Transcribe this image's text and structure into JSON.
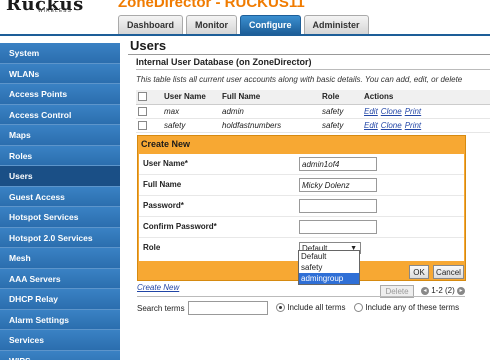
{
  "header": {
    "logo": "Ruckus",
    "logo_sub": "WIRELESS",
    "product_title": "ZoneDirector - RUCKUS11",
    "tabs": [
      "Dashboard",
      "Monitor",
      "Configure",
      "Administer"
    ],
    "active_tab": "Configure"
  },
  "sidebar": {
    "items": [
      {
        "label": "System"
      },
      {
        "label": "WLANs"
      },
      {
        "label": "Access Points"
      },
      {
        "label": "Access Control"
      },
      {
        "label": "Maps"
      },
      {
        "label": "Roles"
      },
      {
        "label": "Users",
        "active": true
      },
      {
        "label": "Guest Access"
      },
      {
        "label": "Hotspot Services"
      },
      {
        "label": "Hotspot 2.0 Services"
      },
      {
        "label": "Mesh"
      },
      {
        "label": "AAA Servers"
      },
      {
        "label": "DHCP Relay"
      },
      {
        "label": "Alarm Settings"
      },
      {
        "label": "Services"
      },
      {
        "label": "WIPS"
      }
    ]
  },
  "main": {
    "page_title": "Users",
    "section_title": "Internal User Database (on ZoneDirector)",
    "description": "This table lists all current user accounts along with basic details. You can add, edit, or delete",
    "table": {
      "columns": [
        "User Name",
        "Full Name",
        "Role",
        "Actions"
      ],
      "rows": [
        {
          "user": "max",
          "full": "admin",
          "role": "safety"
        },
        {
          "user": "safety",
          "full": "holdfastnumbers",
          "role": "safety"
        }
      ],
      "actions": [
        "Edit",
        "Clone",
        "Print"
      ]
    },
    "create": {
      "title": "Create New",
      "fields": {
        "username_label": "User Name*",
        "username_value": "admin1of4",
        "fullname_label": "Full Name",
        "fullname_value": "Micky Dolenz",
        "password_label": "Password*",
        "password_value": "",
        "confirm_label": "Confirm Password*",
        "confirm_value": "",
        "role_label": "Role",
        "role_value": "Default"
      },
      "role_options": [
        "Default",
        "safety",
        "admingroup"
      ],
      "role_highlighted": "admingroup",
      "ok_label": "OK",
      "cancel_label": "Cancel"
    },
    "bottom": {
      "create_new_link": "Create New",
      "delete_label": "Delete",
      "pager_text": "1-2 (2)",
      "search_label": "Search terms",
      "radio_all": "Include all terms",
      "radio_any": "Include any of these terms"
    }
  },
  "colors": {
    "accent_orange": "#f7a833",
    "nav_blue": "#2f74b6",
    "active_tab_blue": "#1d5e98",
    "link_blue": "#2145a6"
  }
}
